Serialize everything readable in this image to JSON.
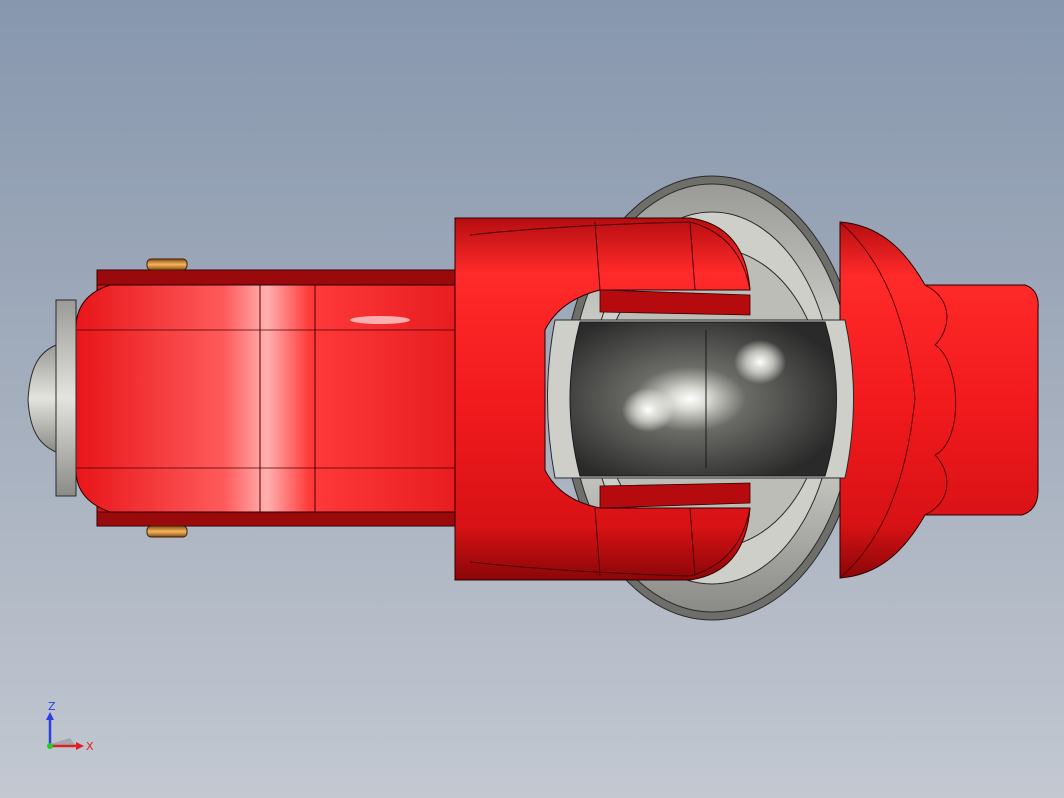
{
  "triad": {
    "z_label": "Z",
    "x_label": "X"
  },
  "colors": {
    "background_top": "#8797ae",
    "background_bottom": "#c3c8d1",
    "arm_red": "#e8181c",
    "arm_red_dark": "#b00d10",
    "flange_gray": "#c9c9c4",
    "sphere_dark": "#3a3a3a",
    "pin_orange": "#e39a3a",
    "axis_z": "#2b3fe0",
    "axis_x": "#e02020"
  }
}
